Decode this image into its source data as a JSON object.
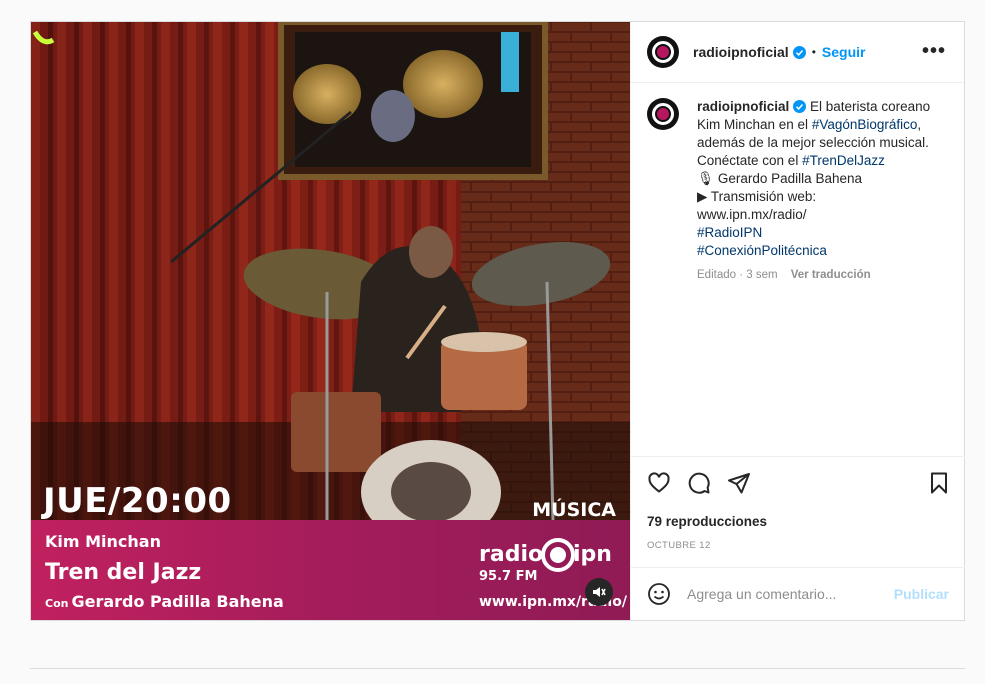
{
  "post": {
    "username": "radioipnoficial",
    "follow_label": "Seguir",
    "more_label": "•••",
    "dot": "•",
    "caption": {
      "line1": "El baterista coreano Kim Minchan en el",
      "tag1": "#VagónBiográfico",
      "line2": ", además de la mejor selección musical. Conéctate con el",
      "tag2": "#TrenDelJazz",
      "line3": "🎙 Gerardo Padilla Bahena",
      "line4": "▶ Transmisión web:",
      "line5": "www.ipn.mx/radio/",
      "tag3": "#RadioIPN",
      "tag4": "#ConexiónPolitécnica"
    },
    "edited": "Editado · 3 sem",
    "translate": "Ver traducción",
    "views": "79 reproducciones",
    "date": "OCTUBRE 12",
    "comment_placeholder": "Agrega un comentario...",
    "publish_label": "Publicar"
  },
  "media": {
    "day_time": "JUE/20:00",
    "genre": "MÚSICA",
    "artist": "Kim Minchan",
    "show": "Tren del Jazz",
    "host_prefix": "Con",
    "host": "Gerardo Padilla Bahena",
    "logo_radio": "radio",
    "logo_ipn": "ipn",
    "logo_freq": "95.7 FM",
    "website": "www.ipn.mx/radio/"
  },
  "colors": {
    "band": "#b01f5c",
    "link": "#0095f6",
    "hashtag": "#00376b",
    "muted": "#8e8e8e"
  }
}
